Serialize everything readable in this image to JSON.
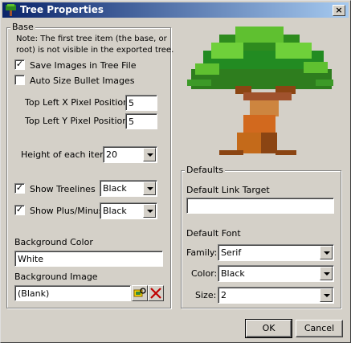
{
  "window": {
    "title": "Tree Properties",
    "close_symbol": "×"
  },
  "base": {
    "group_label": "Base",
    "note": [
      "Note: The first tree item (the base, or",
      "root) is not visible in the exported tree."
    ],
    "save_images": {
      "label": "Save Images in Tree File",
      "checked": true
    },
    "auto_size": {
      "label": "Auto Size Bullet Images",
      "checked": false
    },
    "top_left_x": {
      "label": "Top Left X Pixel Position:",
      "value": "5"
    },
    "top_left_y": {
      "label": "Top Left Y Pixel Position:",
      "value": "5"
    },
    "item_height": {
      "label": "Height of each item:",
      "value": "20"
    },
    "show_treelines": {
      "label": "Show Treelines",
      "checked": true,
      "color": "Black"
    },
    "show_plusminus": {
      "label": "Show Plus/Minus",
      "checked": true,
      "color": "Black"
    },
    "background_color": {
      "label": "Background Color",
      "value": "White"
    },
    "background_image": {
      "label": "Background Image",
      "value": "(Blank)"
    }
  },
  "defaults": {
    "group_label": "Defaults",
    "link_target": {
      "label": "Default Link Target",
      "value": ""
    },
    "font": {
      "label": "Default Font",
      "family": {
        "label": "Family:",
        "value": "Serif"
      },
      "color": {
        "label": "Color:",
        "value": "Black"
      },
      "size": {
        "label": "Size:",
        "value": "2"
      }
    }
  },
  "buttons": {
    "ok": "OK",
    "cancel": "Cancel"
  },
  "icons": {
    "app": "tree-icon",
    "preview": "tree-illustration",
    "browse": "browse-image-icon",
    "clear": "clear-x-icon"
  },
  "colors": {
    "title_start": "#0a246a",
    "title_end": "#a6caf0",
    "face": "#d4d0c8",
    "clear_x": "#c00000"
  }
}
